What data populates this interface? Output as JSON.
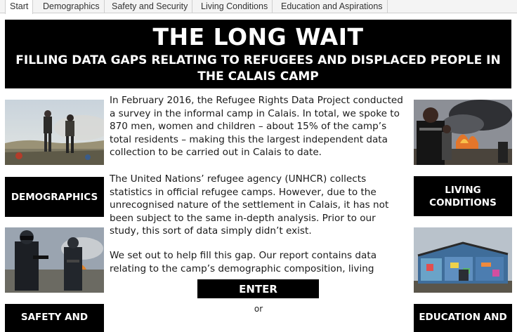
{
  "tabs": [
    "Start",
    "Demographics",
    "Safety and Security",
    "Living Conditions",
    "Education and Aspirations"
  ],
  "banner": {
    "title": "THE LONG WAIT",
    "subtitle": "FILLING DATA GAPS RELATING TO REFUGEES AND DISPLACED PEOPLE IN THE CALAIS CAMP"
  },
  "paragraphs": [
    "In February 2016, the Refugee Rights Data Project conducted a survey in the informal camp in Calais. In total, we spoke to 870 men, women and children – about 15% of the camp’s total residents – making this the largest independent data collection to be carried out in Calais to date.",
    "The United Nations’ refugee agency (UNHCR) collects statistics in official refugee camps. However, due to the unrecognised nature of the settlement in Calais, it has not been subject to the same in-depth analysis. Prior to our study, this sort of data simply didn’t exist.",
    "We set out to help fill this gap. Our report contains data relating to the camp’s demographic composition, living"
  ],
  "nav": {
    "demographics": "DEMOGRAPHICS",
    "living_conditions": "LIVING CONDITIONS",
    "safety": "SAFETY AND",
    "education": "EDUCATION AND"
  },
  "enter_label": "ENTER",
  "or_label": "or"
}
